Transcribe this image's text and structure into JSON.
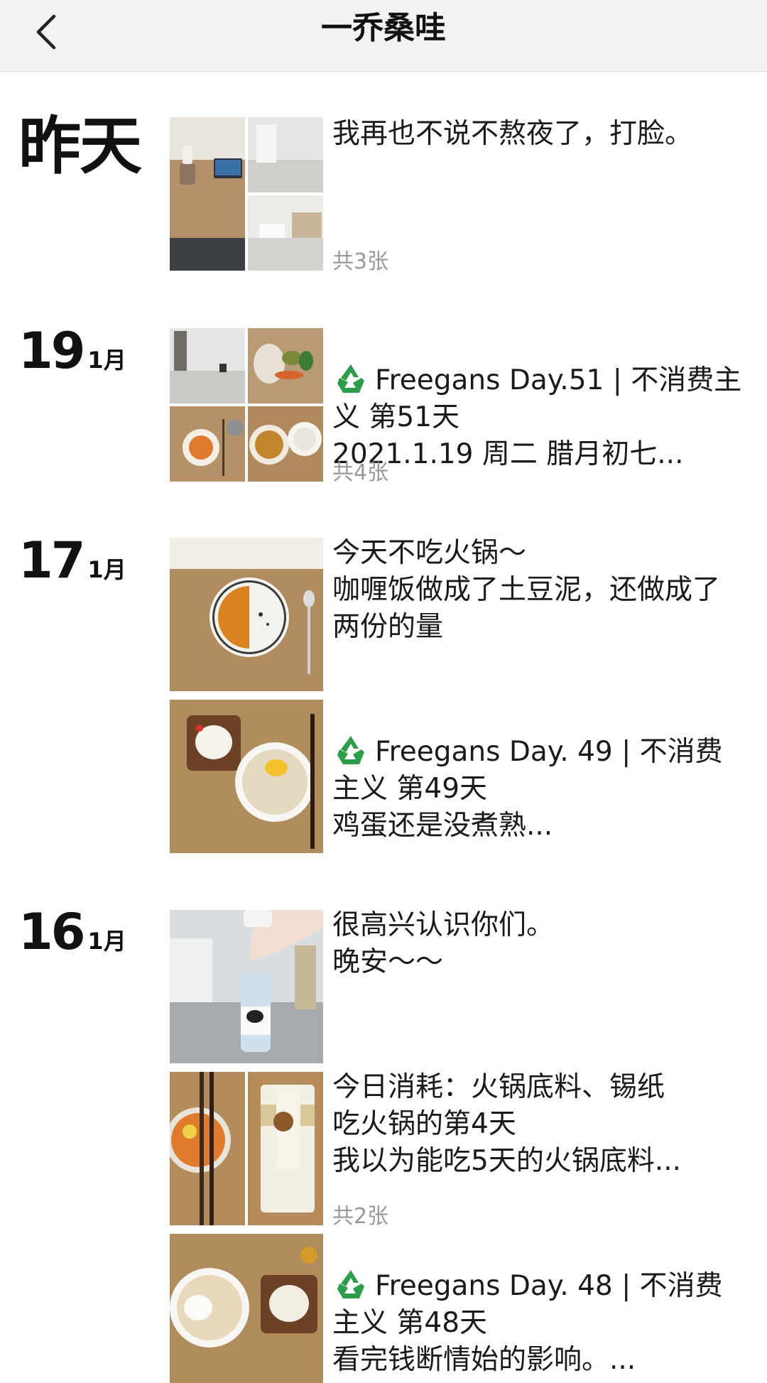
{
  "nav": {
    "title": "一乔桑哇",
    "back_icon": "chevron-left-icon"
  },
  "colors": {
    "recycle_green": "#2e9d4a",
    "count_gray": "#999999"
  },
  "groups": [
    {
      "date_label": "昨天",
      "posts": [
        {
          "text": "我再也不说不熬夜了，打脸。",
          "count": "共3张",
          "images": 3
        }
      ]
    },
    {
      "day": "19",
      "month": "1月",
      "posts": [
        {
          "icon": "recycle-icon",
          "text": "Freegans Day.51 | 不消费主义 第51天\n2021.1.19 周二 腊月初七...",
          "count": "共4张",
          "images": 4
        }
      ]
    },
    {
      "day": "17",
      "month": "1月",
      "posts": [
        {
          "text": "今天不吃火锅～\n咖喱饭做成了土豆泥，还做成了两份的量",
          "images": 1
        },
        {
          "icon": "recycle-icon",
          "text": "Freegans Day. 49 | 不消费主义 第49天\n鸡蛋还是没煮熟...",
          "images": 1
        }
      ]
    },
    {
      "day": "16",
      "month": "1月",
      "posts": [
        {
          "text": "很高兴认识你们。\n晚安～～",
          "images": 1
        },
        {
          "text": "今日消耗：火锅底料、锡纸\n吃火锅的第4天\n我以为能吃5天的火锅底料...",
          "count": "共2张",
          "images": 2
        },
        {
          "icon": "recycle-icon",
          "text": "Freegans Day. 48 | 不消费主义 第48天\n看完钱断情始的影响。...",
          "images": 1
        }
      ]
    }
  ]
}
